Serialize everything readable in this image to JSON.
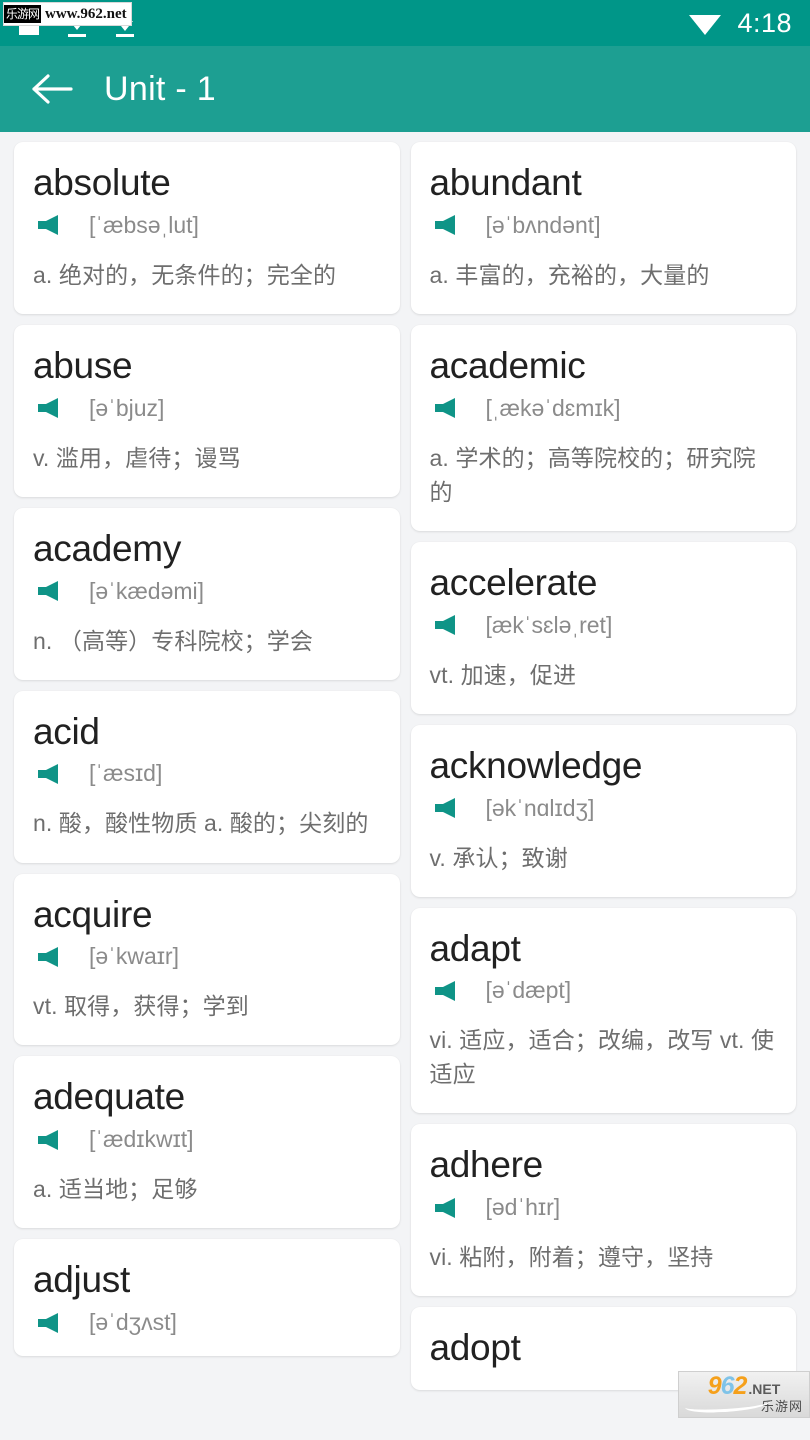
{
  "status_bar": {
    "time": "4:18",
    "icons": [
      "notification-icon",
      "download-arrow-icon",
      "download-complete-icon",
      "wifi-icon"
    ],
    "background_color": "#009688",
    "watermark": {
      "badge": "乐游网",
      "url": "www.962.net"
    }
  },
  "toolbar": {
    "title": "Unit - 1",
    "back_icon": "arrow-left-icon",
    "background_color": "#1d9f92",
    "text_color": "#ffffff"
  },
  "theme": {
    "page_background": "#f3f4f6",
    "card_background": "#ffffff",
    "word_color": "#212121",
    "phonetic_color": "#8b8b8b",
    "meaning_color": "#6e6e6e",
    "speaker_color": "#0f9487"
  },
  "watermark_logo": {
    "digits": "962",
    "suffix": ".NET",
    "chinese": "乐游网"
  },
  "columns": [
    {
      "cards": [
        {
          "word": "absolute",
          "phonetic": "[ˈæbsəˌlut]",
          "meaning": "a. 绝对的，无条件的；完全的",
          "speaker_icon": "speaker-icon"
        },
        {
          "word": "abuse",
          "phonetic": "[əˈbjuz]",
          "meaning": "v. 滥用，虐待；谩骂",
          "speaker_icon": "speaker-icon"
        },
        {
          "word": "academy",
          "phonetic": "[əˈkædəmi]",
          "meaning": "n. （高等）专科院校；学会",
          "speaker_icon": "speaker-icon"
        },
        {
          "word": "acid",
          "phonetic": "[ˈæsɪd]",
          "meaning": "n. 酸，酸性物质 a. 酸的；尖刻的",
          "speaker_icon": "speaker-icon"
        },
        {
          "word": "acquire",
          "phonetic": "[əˈkwaɪr]",
          "meaning": "vt. 取得，获得；学到",
          "speaker_icon": "speaker-icon"
        },
        {
          "word": "adequate",
          "phonetic": "[ˈædɪkwɪt]",
          "meaning": "a. 适当地；足够",
          "speaker_icon": "speaker-icon"
        },
        {
          "word": "adjust",
          "phonetic": "[əˈdʒʌst]",
          "meaning": "",
          "speaker_icon": "speaker-icon"
        }
      ]
    },
    {
      "cards": [
        {
          "word": "abundant",
          "phonetic": "[əˈbʌndənt]",
          "meaning": "a. 丰富的，充裕的，大量的",
          "speaker_icon": "speaker-icon"
        },
        {
          "word": "academic",
          "phonetic": "[ˌækəˈdɛmɪk]",
          "meaning": "a. 学术的；高等院校的；研究院的",
          "speaker_icon": "speaker-icon"
        },
        {
          "word": "accelerate",
          "phonetic": "[ækˈsɛləˌret]",
          "meaning": "vt. 加速，促进",
          "speaker_icon": "speaker-icon"
        },
        {
          "word": "acknowledge",
          "phonetic": "[əkˈnɑlɪdʒ]",
          "meaning": "v. 承认；致谢",
          "speaker_icon": "speaker-icon"
        },
        {
          "word": "adapt",
          "phonetic": "[əˈdæpt]",
          "meaning": "vi. 适应，适合；改编，改写 vt. 使适应",
          "speaker_icon": "speaker-icon"
        },
        {
          "word": "adhere",
          "phonetic": "[ədˈhɪr]",
          "meaning": "vi. 粘附，附着；遵守，坚持",
          "speaker_icon": "speaker-icon"
        },
        {
          "word": "adopt",
          "phonetic": "",
          "meaning": "",
          "speaker_icon": "speaker-icon"
        }
      ]
    }
  ]
}
